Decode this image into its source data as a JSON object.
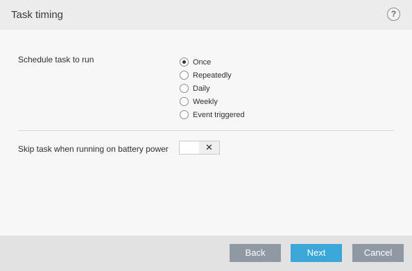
{
  "header": {
    "title": "Task timing",
    "help_glyph": "?"
  },
  "schedule": {
    "label": "Schedule task to run",
    "options": [
      {
        "label": "Once",
        "checked": true
      },
      {
        "label": "Repeatedly",
        "checked": false
      },
      {
        "label": "Daily",
        "checked": false
      },
      {
        "label": "Weekly",
        "checked": false
      },
      {
        "label": "Event triggered",
        "checked": false
      }
    ]
  },
  "battery": {
    "label": "Skip task when running on battery power",
    "toggle_state_glyph": "✕",
    "enabled": false
  },
  "footer": {
    "back_label": "Back",
    "next_label": "Next",
    "cancel_label": "Cancel"
  },
  "colors": {
    "next_button": "#3aa7d8",
    "secondary_button": "#8e99a3"
  }
}
